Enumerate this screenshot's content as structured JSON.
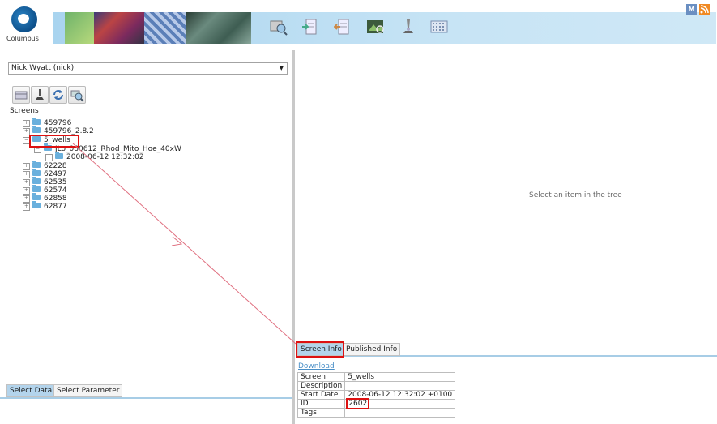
{
  "app": {
    "logo_text": "Columbus"
  },
  "corner": {
    "m_label": "M",
    "rss_label": ""
  },
  "toolbar": {
    "icons": [
      "search-plate-icon",
      "import-icon",
      "export-icon",
      "image-analysis-icon",
      "microscope-icon",
      "plate-grid-icon"
    ]
  },
  "user_select": {
    "value": "Nick Wyatt (nick)"
  },
  "left_icons": [
    "plate-icon",
    "microscope-icon",
    "refresh-icon",
    "search-icon"
  ],
  "tree": {
    "root_label": "Screens",
    "nodes": [
      {
        "label": "459796",
        "depth": 0
      },
      {
        "label": "459796_2.8.2",
        "depth": 0
      },
      {
        "label": "5_wells",
        "depth": 0,
        "expanded": true
      },
      {
        "label": "JLo_080612_Rhod_Mito_Hoe_40xW",
        "depth": 1
      },
      {
        "label": "2008-06-12 12:32:02",
        "depth": 2
      },
      {
        "label": "62228",
        "depth": 0
      },
      {
        "label": "62497",
        "depth": 0
      },
      {
        "label": "62535",
        "depth": 0
      },
      {
        "label": "62574",
        "depth": 0
      },
      {
        "label": "62858",
        "depth": 0
      },
      {
        "label": "62877",
        "depth": 0
      }
    ]
  },
  "bottom_left_tabs": [
    "Select Data",
    "Select Parameter"
  ],
  "right": {
    "empty_message": "Select an item in the tree",
    "tabs": [
      "Screen Info",
      "Published Info"
    ],
    "download_label": "Download",
    "info_rows": [
      {
        "key": "Screen",
        "value": "5_wells"
      },
      {
        "key": "Description",
        "value": ""
      },
      {
        "key": "Start Date",
        "value": "2008-06-12 12:32:02 +0100"
      },
      {
        "key": "ID",
        "value": "2602"
      },
      {
        "key": "Tags",
        "value": ""
      }
    ]
  },
  "colors": {
    "accent": "#a7cde6",
    "highlight": "#dd1111",
    "folder": "#6ab0dd"
  }
}
